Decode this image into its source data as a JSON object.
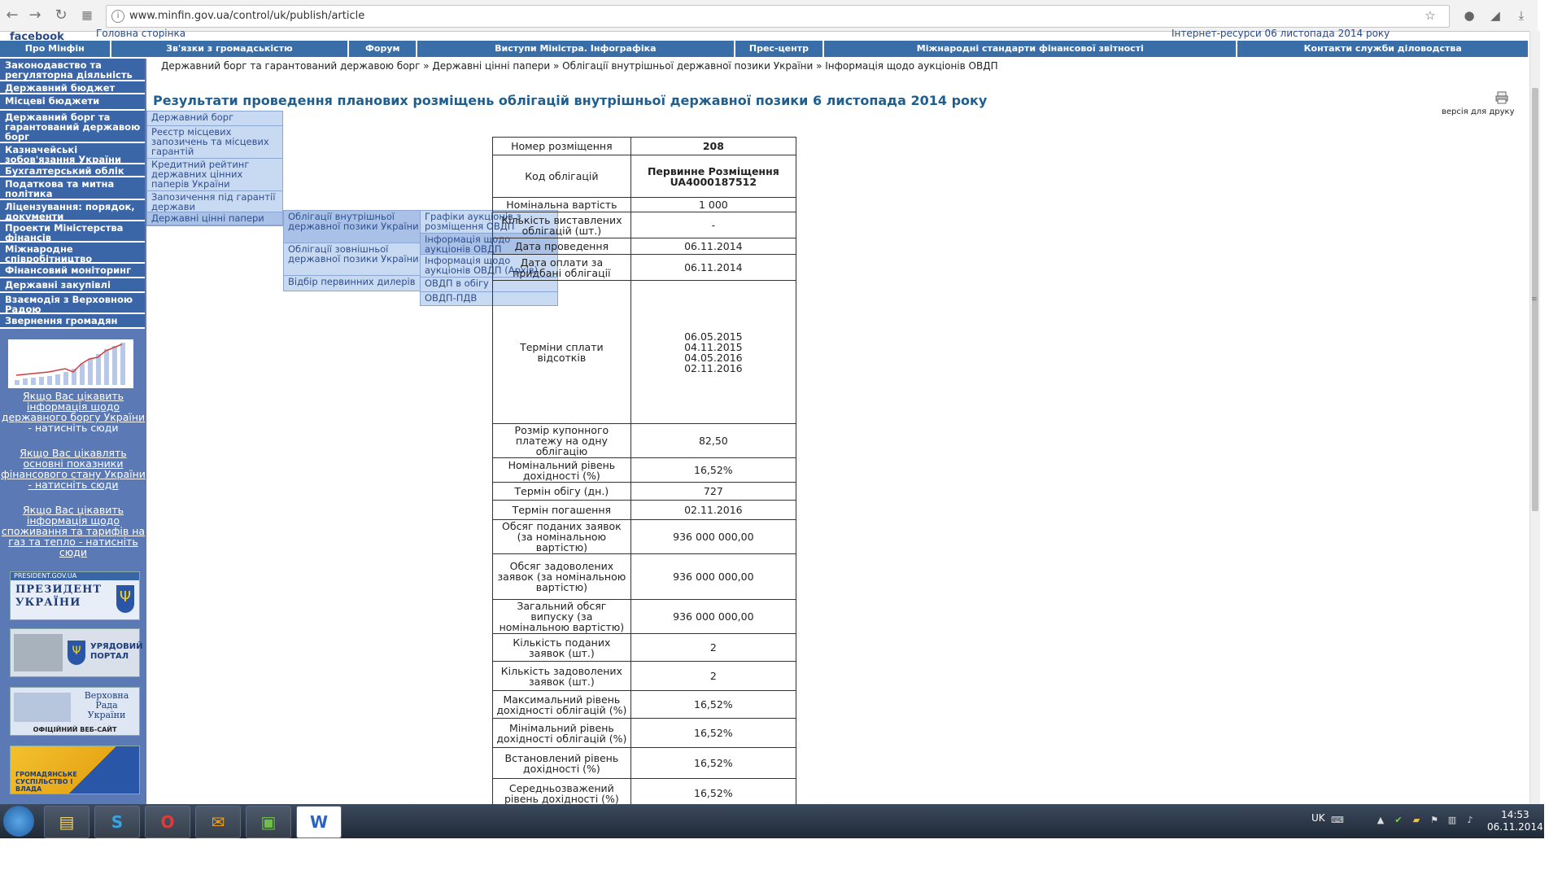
{
  "browser": {
    "url": "www.minfin.gov.ua/control/uk/publish/article"
  },
  "header": {
    "facebook": "facebook",
    "home_link": "Головна сторінка",
    "info_text": "Інтернет-ресурси 06 листопада 2014 року"
  },
  "topnav": [
    {
      "label": "Про Мінфін"
    },
    {
      "label": "Зв'язки з громадськістю"
    },
    {
      "label": "Форум"
    },
    {
      "label": "Виступи Міністра. Інфографіка"
    },
    {
      "label": "Прес-центр"
    },
    {
      "label": "Міжнародні стандарти фінансової звітності"
    },
    {
      "label": "Контакти служби діловодства"
    }
  ],
  "sidebar": {
    "items": [
      {
        "label": "Законодавство та регуляторна діяльність"
      },
      {
        "label": "Державний бюджет"
      },
      {
        "label": "Місцеві бюджети"
      },
      {
        "label": "Державний борг та гарантований державою борг"
      },
      {
        "label": "Казначейські зобов'язання України"
      },
      {
        "label": "Бухгалтерський облік"
      },
      {
        "label": "Податкова та митна політика"
      },
      {
        "label": "Ліцензування: порядок, документи"
      },
      {
        "label": "Проекти Міністерства фінансів"
      },
      {
        "label": "Міжнародне співробітництво"
      },
      {
        "label": "Фінансовий моніторинг"
      },
      {
        "label": "Державні закупівлі"
      },
      {
        "label": "Взаємодія з Верховною Радою"
      },
      {
        "label": "Звернення громадян"
      }
    ],
    "links": [
      {
        "text": "Якщо Вас цікавить інформація щодо державного боргу України",
        "suffix": " - натисніть сюди"
      },
      {
        "text": "Якщо Вас цікавлять основні показники фінансового стану України - натисніть сюди",
        "suffix": ""
      },
      {
        "text": "Якщо Вас цікавить інформація щодо споживання та тарифів на газ та тепло - натисніть сюди",
        "suffix": ""
      }
    ],
    "banners": [
      {
        "small": "PRESIDENT.GOV.UA",
        "main": "ПРЕЗИДЕНТ УКРАЇНИ"
      },
      {
        "main": "УРЯДОВИЙ ПОРТАЛ"
      },
      {
        "main": "Верховна Рада України",
        "small": "ОФІЦІЙНИЙ ВЕБ-САЙТ"
      },
      {
        "main": "ГРОМАДЯНСЬКЕ СУСПІЛЬСТВО І ВЛАДА"
      }
    ]
  },
  "menu1": [
    {
      "label": "Державний борг"
    },
    {
      "label": "Реєстр місцевих запозичень та місцевих гарантій"
    },
    {
      "label": "Кредитний рейтинг державних цінних паперів України"
    },
    {
      "label": "Запозичення під гарантії держави"
    },
    {
      "label": "Державні цінні папери"
    }
  ],
  "menu2": [
    {
      "label": "Облігації внутрішньої державної позики України"
    },
    {
      "label": "Облігації зовнішньої державної позики України"
    },
    {
      "label": "Відбір первинних дилерів"
    }
  ],
  "menu3": [
    {
      "label": "Графіки аукціонів з розміщення ОВДП"
    },
    {
      "label": "Інформація щодо аукціонів ОВДП"
    },
    {
      "label": "Інформація щодо аукціонів ОВДП (Архів)"
    },
    {
      "label": "ОВДП в обігу"
    },
    {
      "label": "ОВДП-ПДВ"
    }
  ],
  "breadcrumb": "Державний борг та гарантований державою борг  »  Державні цінні папери  »  Облігації внутрішньої державної позики України  »  Інформація щодо аукціонів ОВДП",
  "title": "Результати проведення планових розміщень облігацій внутрішньої державної позики 6 листопада 2014 року",
  "print_label": "версія для друку",
  "table": [
    {
      "label": "Номер розміщення",
      "value": "208",
      "bold": true
    },
    {
      "label": "Код облігацій",
      "value": "Первинне Розміщення UA4000187512",
      "bold": true
    },
    {
      "label": "Номінальна вартість",
      "value": "1 000"
    },
    {
      "label": "Кількість виставлених облігацій (шт.)",
      "value": "-"
    },
    {
      "label": "Дата проведення",
      "value": "06.11.2014"
    },
    {
      "label": "Дата оплати за придбані облігації",
      "value": "06.11.2014"
    },
    {
      "label": "Терміни сплати відсотків",
      "value": "06.05.2015\n04.11.2015\n04.05.2016\n02.11.2016"
    },
    {
      "label": "Розмір купонного платежу на одну облігацію",
      "value": "82,50"
    },
    {
      "label": "Номінальний рівень дохідності (%)",
      "value": "16,52%"
    },
    {
      "label": "Термін обігу (дн.)",
      "value": "727"
    },
    {
      "label": "Термін погашення",
      "value": "02.11.2016"
    },
    {
      "label": "Обсяг поданих заявок (за номінальною вартістю)",
      "value": "936 000 000,00"
    },
    {
      "label": "Обсяг задоволених заявок (за номінальною вартістю)",
      "value": "936 000 000,00"
    },
    {
      "label": "Загальний обсяг випуску (за номінальною вартістю)",
      "value": "936 000 000,00"
    },
    {
      "label": "Кількість поданих заявок (шт.)",
      "value": "2"
    },
    {
      "label": "Кількість задоволених заявок (шт.)",
      "value": "2"
    },
    {
      "label": "Максимальний рівень дохідності облігацій (%)",
      "value": "16,52%"
    },
    {
      "label": "Мінімальний рівень дохідності облігацій (%)",
      "value": "16,52%"
    },
    {
      "label": "Встановлений рівень дохідності (%)",
      "value": "16,52%"
    },
    {
      "label": "Середньозважений рівень дохідності (%)",
      "value": "16,52%"
    }
  ],
  "taskbar": {
    "lang": "UK",
    "time": "14:53",
    "date": "06.11.2014"
  }
}
